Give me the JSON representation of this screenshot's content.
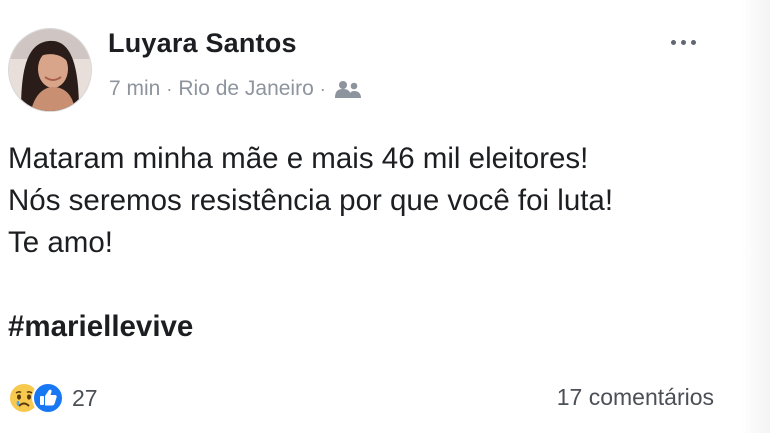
{
  "post": {
    "author": "Luyara Santos",
    "time": "7 min",
    "separator": "·",
    "location": "Rio de Janeiro",
    "audience_icon": "group-icon",
    "more_icon": "more-options-icon",
    "text_lines": [
      "Mataram minha mãe e mais 46 mil eleitores!",
      "Nós seremos resistência por que você foi luta!",
      "Te amo!"
    ],
    "hashtag": "#mariellevive"
  },
  "footer": {
    "reaction_icons": [
      "sad-reaction-icon",
      "like-reaction-icon"
    ],
    "reaction_count": "27",
    "comments_label": "17 comentários"
  },
  "colors": {
    "text": "#1c1e21",
    "meta": "#8d949e",
    "like_blue": "#1877f2",
    "sad_yellow": "#f7c94f"
  }
}
